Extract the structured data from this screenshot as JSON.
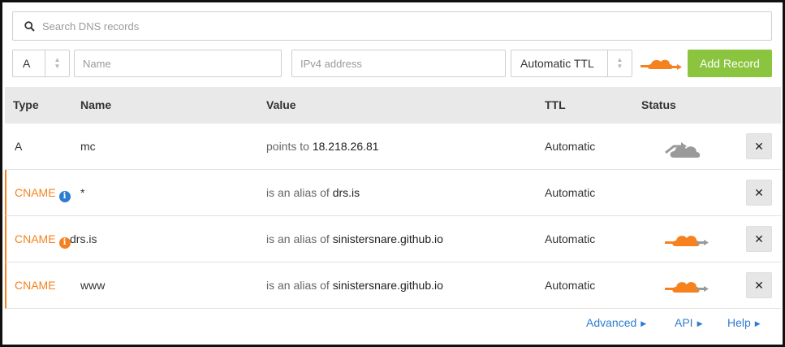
{
  "search": {
    "placeholder": "Search DNS records",
    "icon": "search-icon"
  },
  "add_record": {
    "type_value": "A",
    "name_placeholder": "Name",
    "value_placeholder": "IPv4 address",
    "ttl_value": "Automatic TTL",
    "proxy_icon": "cloud-proxied-icon",
    "add_label": "Add Record"
  },
  "table": {
    "headers": [
      "Type",
      "Name",
      "Value",
      "TTL",
      "Status"
    ],
    "rows": [
      {
        "type": "A",
        "name": "mc",
        "value_prefix": "points to ",
        "value_main": "18.218.26.81",
        "ttl": "Automatic",
        "status": "dns-only"
      },
      {
        "type": "CNAME",
        "info": "i",
        "name": "*",
        "value_prefix": "is an alias of ",
        "value_main": "drs.is",
        "ttl": "Automatic",
        "status": "none"
      },
      {
        "type": "CNAME",
        "info": "i",
        "name": "drs.is",
        "value_prefix": "is an alias of ",
        "value_main": "sinistersnare.github.io",
        "ttl": "Automatic",
        "status": "proxied"
      },
      {
        "type": "CNAME",
        "name": "www",
        "value_prefix": "is an alias of ",
        "value_main": "sinistersnare.github.io",
        "ttl": "Automatic",
        "status": "proxied"
      }
    ],
    "delete_symbol": "✕"
  },
  "footer": {
    "advanced": "Advanced",
    "api": "API",
    "help": "Help"
  },
  "colors": {
    "accent_orange": "#f6821f",
    "link_blue": "#2c7cd1",
    "add_green": "#8bc53f",
    "header_gray": "#e9e9e9",
    "cloud_gray": "#9a9a9a"
  }
}
